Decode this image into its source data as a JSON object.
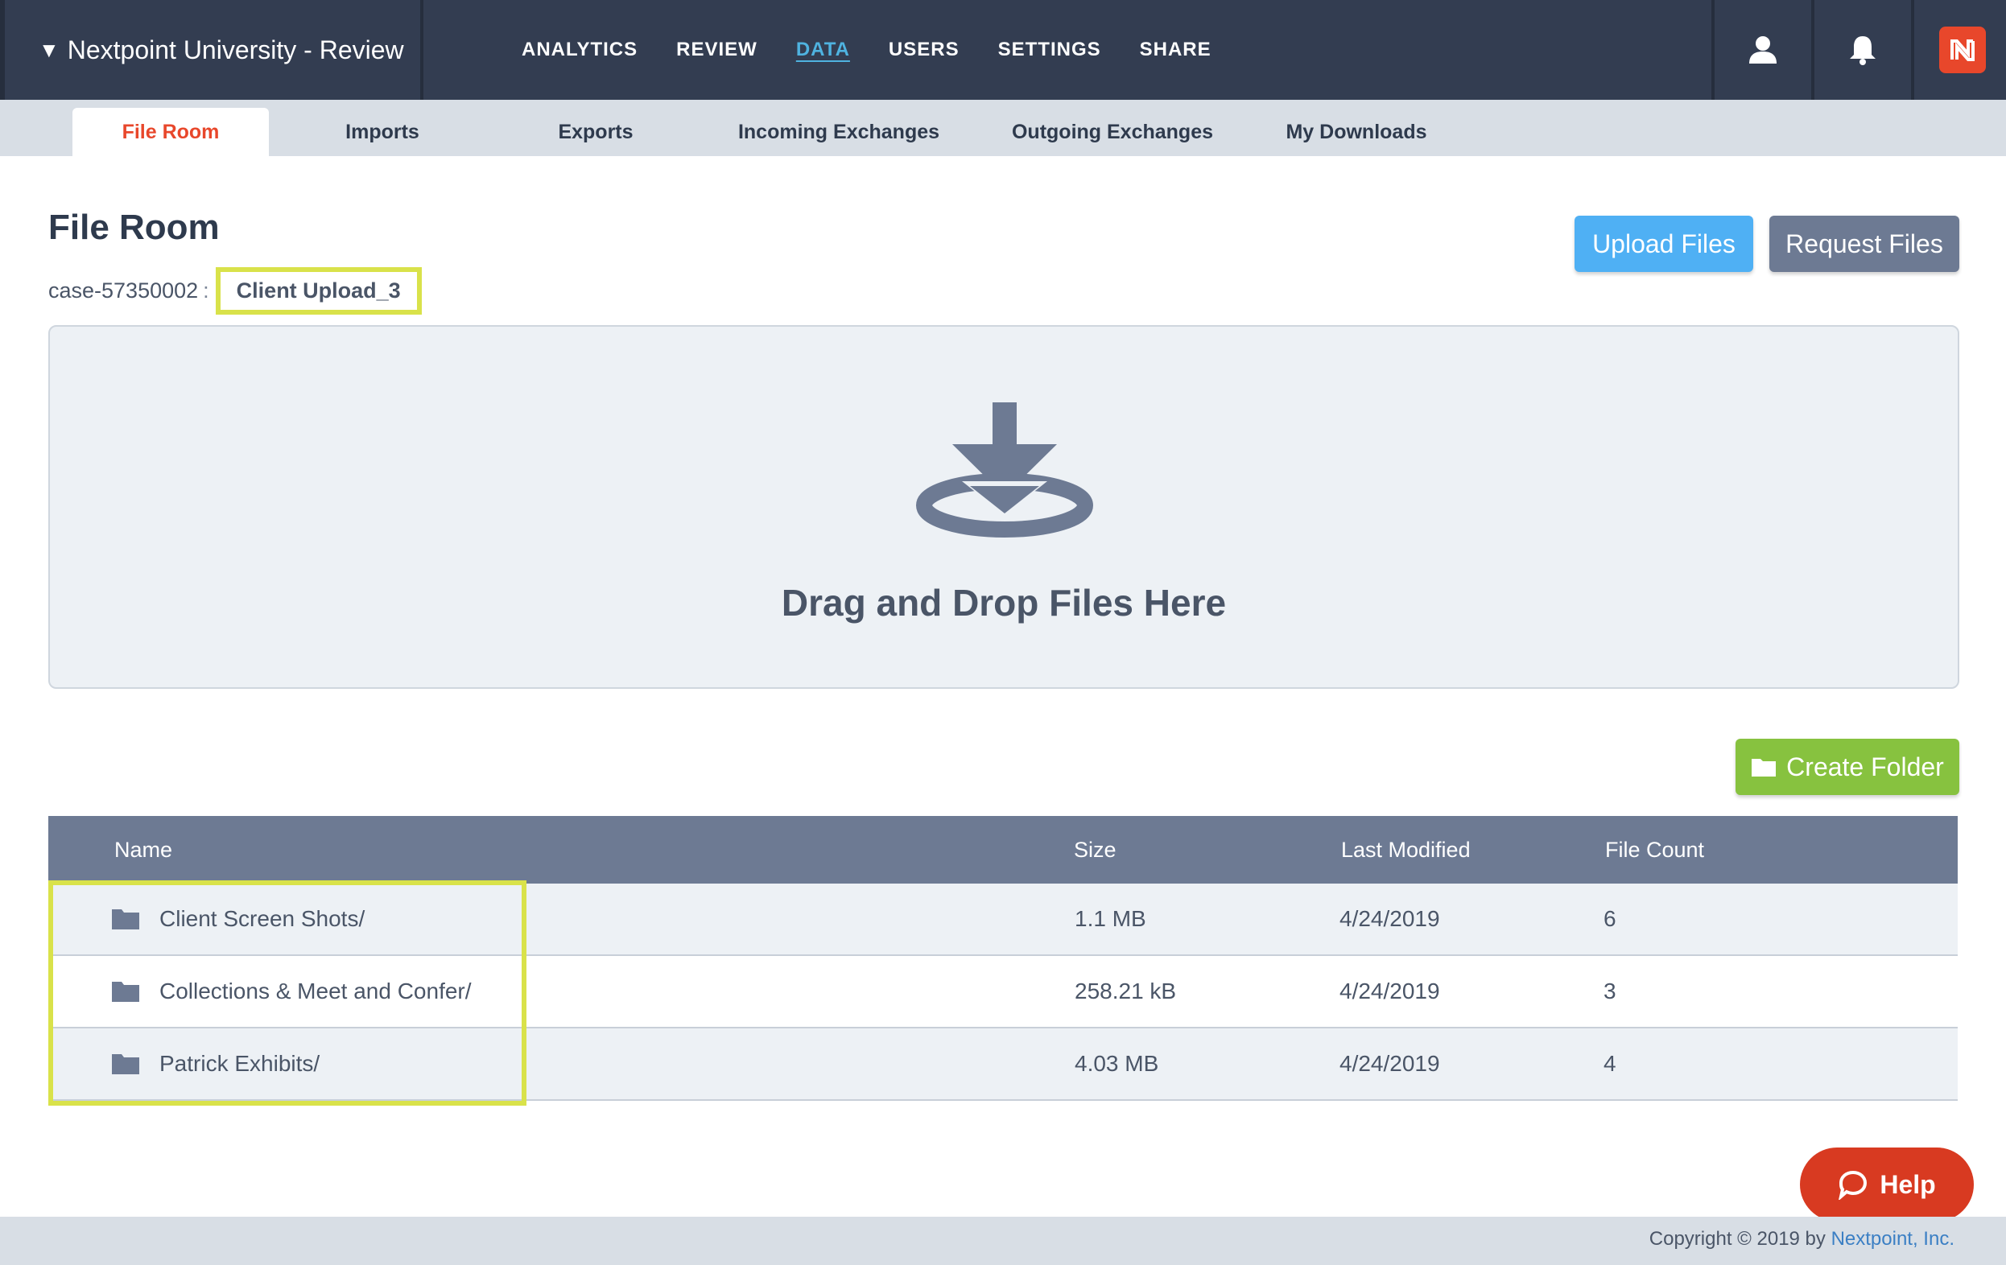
{
  "header": {
    "case_title": "Nextpoint University - Review",
    "nav": [
      {
        "label": "ANALYTICS"
      },
      {
        "label": "REVIEW"
      },
      {
        "label": "DATA",
        "active": true
      },
      {
        "label": "USERS"
      },
      {
        "label": "SETTINGS"
      },
      {
        "label": "SHARE"
      }
    ],
    "icons": [
      "user-icon",
      "bell-icon",
      "nextpoint-logo"
    ]
  },
  "subtabs": [
    {
      "label": "File Room",
      "active": true
    },
    {
      "label": "Imports"
    },
    {
      "label": "Exports"
    },
    {
      "label": "Incoming Exchanges"
    },
    {
      "label": "Outgoing Exchanges"
    },
    {
      "label": "My Downloads"
    }
  ],
  "page": {
    "title": "File Room",
    "breadcrumb": {
      "root": "case-57350002",
      "separator": ":",
      "current": "Client Upload_3"
    },
    "upload_button": "Upload Files",
    "request_button": "Request Files",
    "dropzone_text": "Drag and Drop Files Here",
    "create_folder_button": "Create Folder"
  },
  "table": {
    "columns": [
      "Name",
      "Size",
      "Last Modified",
      "File Count"
    ],
    "rows": [
      {
        "name": "Client Screen Shots/",
        "size": "1.1 MB",
        "modified": "4/24/2019",
        "count": "6"
      },
      {
        "name": "Collections & Meet and Confer/",
        "size": "258.21 kB",
        "modified": "4/24/2019",
        "count": "3"
      },
      {
        "name": "Patrick Exhibits/",
        "size": "4.03 MB",
        "modified": "4/24/2019",
        "count": "4"
      }
    ]
  },
  "help_button": "Help",
  "footer": {
    "copyright": "Copyright © 2019 by",
    "company": "Nextpoint, Inc."
  },
  "colors": {
    "navbar": "#333d51",
    "active_tab": "#e8472b",
    "upload": "#4fb0f4",
    "request": "#6d7a93",
    "create_folder": "#87c23f",
    "help": "#d83a21",
    "highlight": "#d9e24a"
  }
}
